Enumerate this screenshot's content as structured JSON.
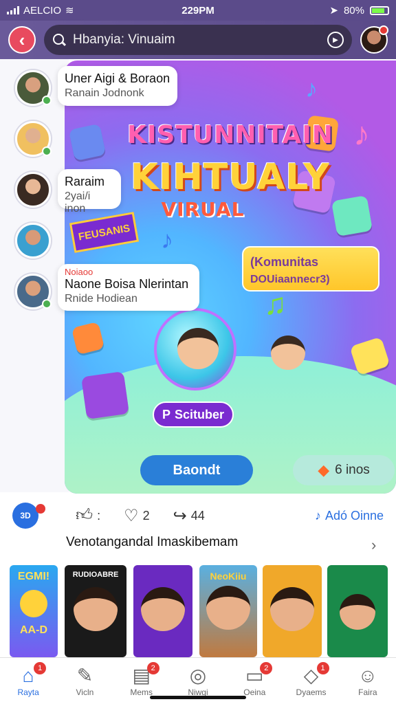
{
  "status_bar": {
    "carrier": "AELCIO",
    "time": "229PM",
    "battery": "80%"
  },
  "header": {
    "search_text": "Hbanyia: Vinuaim",
    "back_symbol": "‹"
  },
  "contacts": [
    {
      "name": "Uner Aigi & Boraon",
      "sub": "Ranain Jodnonk"
    },
    {
      "name": "Raraim",
      "sub": "2yai/i inon"
    },
    {
      "tag": "Noiaoo",
      "name": "Naone Boisa Nlerintan",
      "sub": "Rnide Hodiean"
    }
  ],
  "banner": {
    "title_line1": "KISTUNNITAIN",
    "title_line2": "KIHTUALY",
    "title_line3": "VIRUAL",
    "sticker_text": "FEUSANIS",
    "speech_line1": "(Komunitas",
    "speech_line2": "DOUiaannecr3)",
    "subscribe_label": "Scituber",
    "subscribe_prefix": "P",
    "main_button": "Baondt",
    "now_button": "6 inos"
  },
  "actions": {
    "logo_text": "3D",
    "like_count": ":",
    "heart_count": "2",
    "share_count": "44",
    "add_label": "Adó Oinne"
  },
  "section": {
    "title": "Venotangandal Imaskibemam"
  },
  "thumbnails": [
    {
      "label": "EGMI!",
      "sub": "AA-D"
    },
    {
      "label": "RUDIOABRE"
    },
    {
      "label": ""
    },
    {
      "label": "NeoKiiu"
    },
    {
      "label": ""
    },
    {
      "label": ""
    }
  ],
  "tabs": [
    {
      "label": "Rayta",
      "badge": "1",
      "icon": "home-icon"
    },
    {
      "label": "Vicln",
      "badge": "",
      "icon": "edit-icon"
    },
    {
      "label": "Mems",
      "badge": "2",
      "icon": "clipboard-icon"
    },
    {
      "label": "Niwgi",
      "badge": "",
      "icon": "explore-icon"
    },
    {
      "label": "Oeina",
      "badge": "2",
      "icon": "chat-icon"
    },
    {
      "label": "Dyaems",
      "badge": "1",
      "icon": "message-icon"
    },
    {
      "label": "Faira",
      "badge": "",
      "icon": "profile-icon"
    }
  ],
  "colors": {
    "accent": "#2a6fe0",
    "header": "#5b4b8a",
    "badge": "#e53935"
  }
}
